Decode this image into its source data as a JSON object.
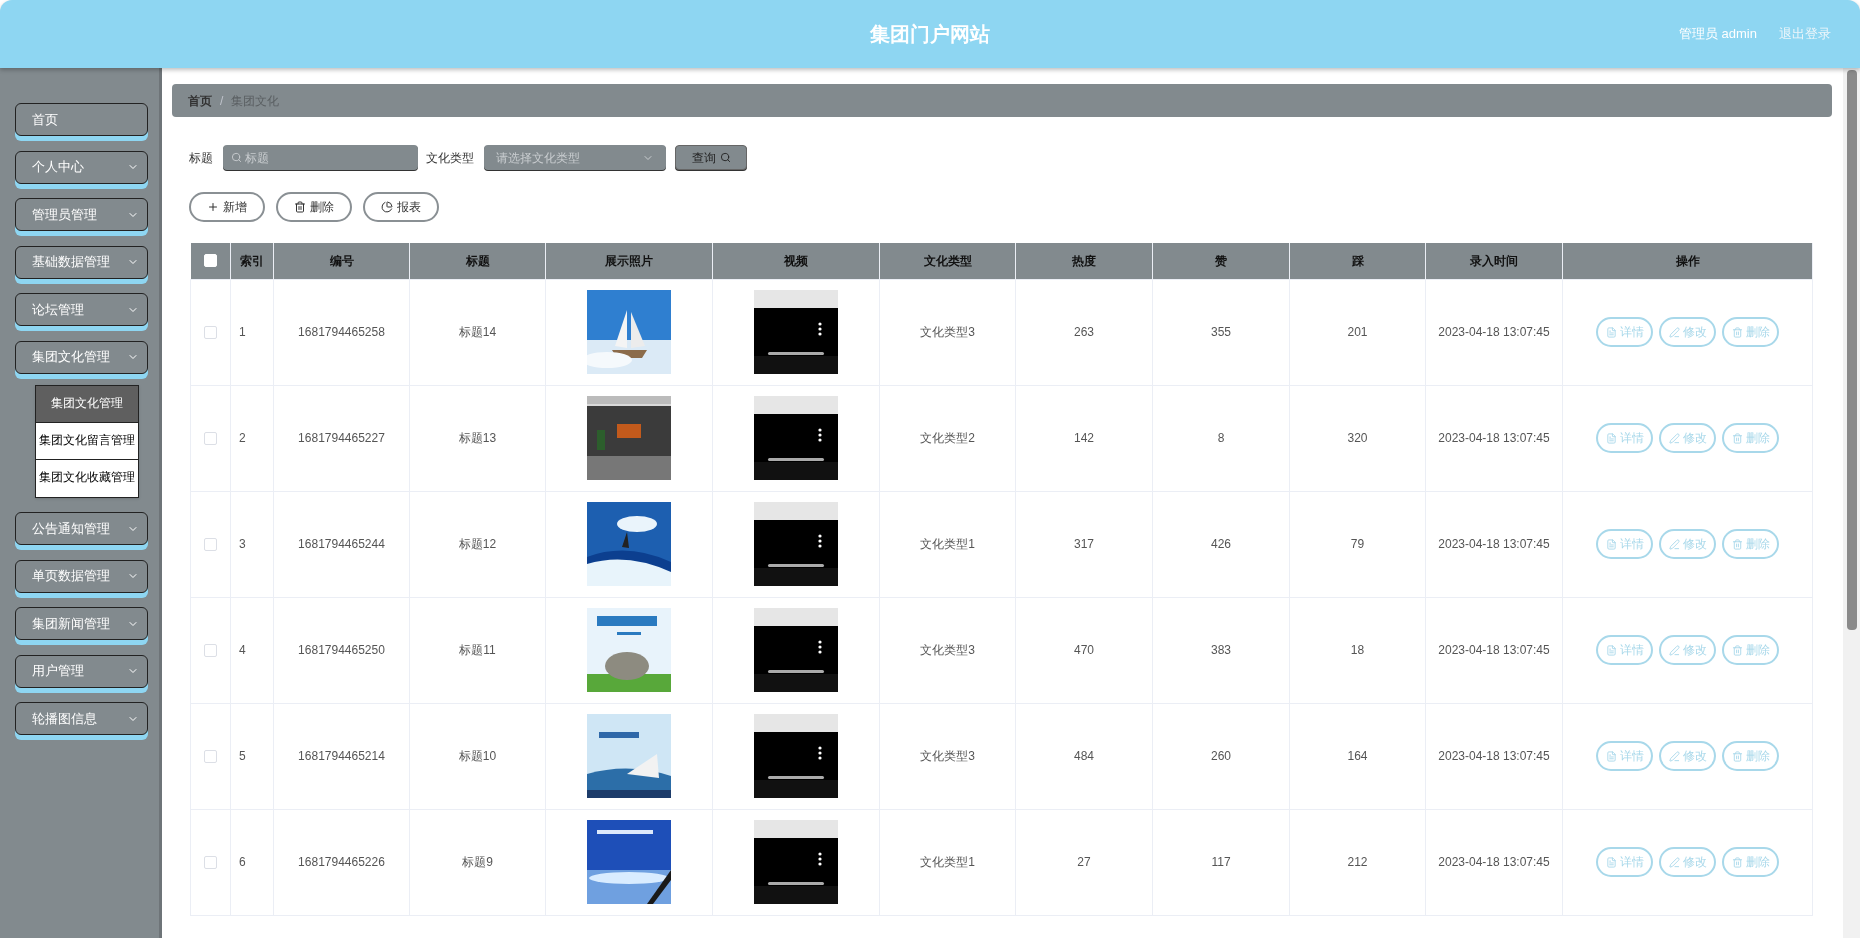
{
  "header": {
    "title": "集团门户网站",
    "user": "管理员 admin",
    "logout": "退出登录"
  },
  "sidebar": {
    "items": [
      {
        "label": "首页",
        "kind": "link"
      },
      {
        "label": "个人中心",
        "kind": "menu"
      },
      {
        "label": "管理员管理",
        "kind": "menu"
      },
      {
        "label": "基础数据管理",
        "kind": "menu"
      },
      {
        "label": "论坛管理",
        "kind": "menu"
      },
      {
        "label": "集团文化管理",
        "kind": "menu",
        "children": [
          {
            "label": "集团文化管理",
            "selected": true
          },
          {
            "label": "集团文化留言管理",
            "selected": false
          },
          {
            "label": "集团文化收藏管理",
            "selected": false
          }
        ]
      },
      {
        "label": "公告通知管理",
        "kind": "menu"
      },
      {
        "label": "单页数据管理",
        "kind": "menu"
      },
      {
        "label": "集团新闻管理",
        "kind": "menu"
      },
      {
        "label": "用户管理",
        "kind": "menu"
      },
      {
        "label": "轮播图信息",
        "kind": "menu"
      }
    ]
  },
  "breadcrumb": [
    "首页",
    "/",
    "集团文化"
  ],
  "search": {
    "title_label": "标题",
    "title_placeholder": "标题",
    "type_label": "文化类型",
    "type_placeholder": "请选择文化类型",
    "button": "查询"
  },
  "actions": [
    {
      "label": "新增",
      "kind": "add"
    },
    {
      "label": "删除",
      "kind": "delete"
    },
    {
      "label": "报表",
      "kind": "report"
    }
  ],
  "table": {
    "select_all": {
      "checked": false
    },
    "columns": [
      "索引",
      "编号",
      "标题",
      "展示照片",
      "视频",
      "文化类型",
      "热度",
      "赞",
      "踩",
      "录入时间",
      "操作"
    ],
    "rows": [
      {
        "checked": false,
        "index": "1",
        "id": "1681794465258",
        "title": "标题14",
        "type": "文化类型3",
        "heat": "263",
        "likes": "355",
        "dislikes": "201",
        "time": "2023-04-18 13:07:45",
        "buttons": [
          {
            "label": "详情",
            "kind": "detail"
          },
          {
            "label": "修改",
            "kind": "edit"
          },
          {
            "label": "删除",
            "kind": "delete"
          }
        ]
      },
      {
        "checked": false,
        "index": "2",
        "id": "1681794465227",
        "title": "标题13",
        "type": "文化类型2",
        "heat": "142",
        "likes": "8",
        "dislikes": "320",
        "time": "2023-04-18 13:07:45",
        "buttons": [
          {
            "label": "详情",
            "kind": "detail"
          },
          {
            "label": "修改",
            "kind": "edit"
          },
          {
            "label": "删除",
            "kind": "delete"
          }
        ]
      },
      {
        "checked": false,
        "index": "3",
        "id": "1681794465244",
        "title": "标题12",
        "type": "文化类型1",
        "heat": "317",
        "likes": "426",
        "dislikes": "79",
        "time": "2023-04-18 13:07:45",
        "buttons": [
          {
            "label": "详情",
            "kind": "detail"
          },
          {
            "label": "修改",
            "kind": "edit"
          },
          {
            "label": "删除",
            "kind": "delete"
          }
        ]
      },
      {
        "checked": false,
        "index": "4",
        "id": "1681794465250",
        "title": "标题11",
        "type": "文化类型3",
        "heat": "470",
        "likes": "383",
        "dislikes": "18",
        "time": "2023-04-18 13:07:45",
        "buttons": [
          {
            "label": "详情",
            "kind": "detail"
          },
          {
            "label": "修改",
            "kind": "edit"
          },
          {
            "label": "删除",
            "kind": "delete"
          }
        ]
      },
      {
        "checked": false,
        "index": "5",
        "id": "1681794465214",
        "title": "标题10",
        "type": "文化类型3",
        "heat": "484",
        "likes": "260",
        "dislikes": "164",
        "time": "2023-04-18 13:07:45",
        "buttons": [
          {
            "label": "详情",
            "kind": "detail"
          },
          {
            "label": "修改",
            "kind": "edit"
          },
          {
            "label": "删除",
            "kind": "delete"
          }
        ]
      },
      {
        "checked": false,
        "index": "6",
        "id": "1681794465226",
        "title": "标题9",
        "type": "文化类型1",
        "heat": "27",
        "likes": "117",
        "dislikes": "212",
        "time": "2023-04-18 13:07:45",
        "buttons": [
          {
            "label": "详情",
            "kind": "detail"
          },
          {
            "label": "修改",
            "kind": "edit"
          },
          {
            "label": "删除",
            "kind": "delete"
          }
        ]
      }
    ]
  }
}
